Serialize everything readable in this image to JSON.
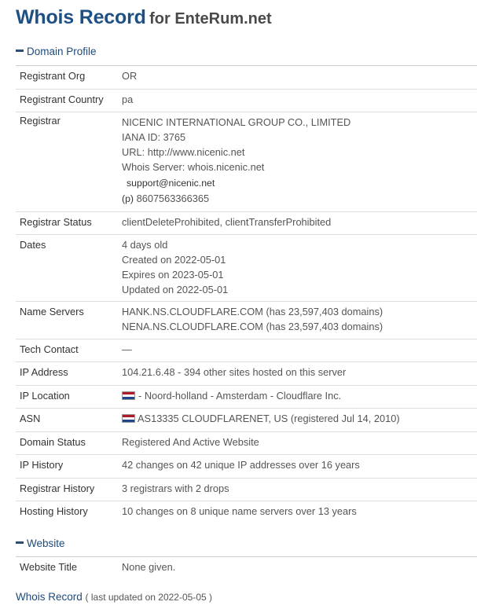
{
  "header": {
    "title": "Whois Record",
    "subtitle": "for EnteRum.net"
  },
  "sections": {
    "domain_profile": "Domain Profile",
    "website": "Website"
  },
  "profile": {
    "registrant_org": {
      "label": "Registrant Org",
      "value": "OR"
    },
    "registrant_country": {
      "label": "Registrant Country",
      "value": "pa"
    },
    "registrar": {
      "label": "Registrar",
      "name": "NICENIC INTERNATIONAL GROUP CO., LIMITED",
      "iana": "IANA ID: 3765",
      "url": "URL: http://www.nicenic.net",
      "whois_server": "Whois Server: whois.nicenic.net",
      "email": "support@nicenic.net",
      "phone_prefix": "(p)",
      "phone": "8607563366365"
    },
    "registrar_status": {
      "label": "Registrar Status",
      "value": "clientDeleteProhibited, clientTransferProhibited"
    },
    "dates": {
      "label": "Dates",
      "age": "4 days old",
      "created": "Created on 2022-05-01",
      "expires": "Expires on 2023-05-01",
      "updated": "Updated on 2022-05-01"
    },
    "name_servers": {
      "label": "Name Servers",
      "ns1": "HANK.NS.CLOUDFLARE.COM (has 23,597,403 domains)",
      "ns2": "NENA.NS.CLOUDFLARE.COM (has 23,597,403 domains)"
    },
    "tech_contact": {
      "label": "Tech Contact",
      "value": "—"
    },
    "ip_address": {
      "label": "IP Address",
      "value": "104.21.6.48 - 394 other sites hosted on this server"
    },
    "ip_location": {
      "label": "IP Location",
      "value": "- Noord-holland - Amsterdam - Cloudflare Inc."
    },
    "asn": {
      "label": "ASN",
      "value": "AS13335 CLOUDFLARENET, US (registered Jul 14, 2010)"
    },
    "domain_status": {
      "label": "Domain Status",
      "value": "Registered And Active Website"
    },
    "ip_history": {
      "label": "IP History",
      "value": "42 changes on 42 unique IP addresses over 16 years"
    },
    "registrar_history": {
      "label": "Registrar History",
      "value": "3 registrars with 2 drops"
    },
    "hosting_history": {
      "label": "Hosting History",
      "value": "10 changes on 8 unique name servers over 13 years"
    }
  },
  "website": {
    "title": {
      "label": "Website Title",
      "value": "None given."
    }
  },
  "footer": {
    "title": "Whois Record",
    "updated": "( last updated on 2022-05-05 )"
  },
  "colors": {
    "title": "#1e5083",
    "section": "#1e4a7a",
    "flag": "netherlands-flag"
  }
}
